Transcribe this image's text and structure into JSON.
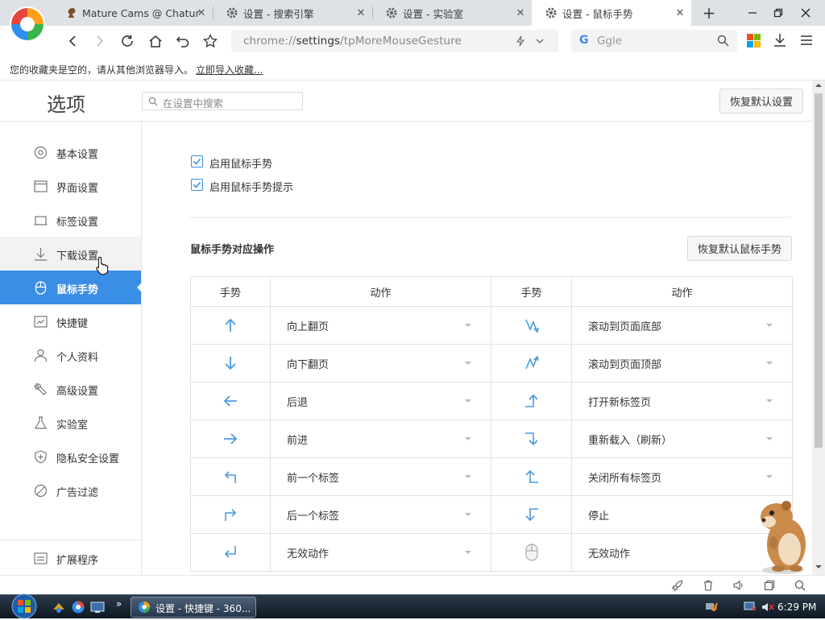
{
  "browser": {
    "tabs": [
      {
        "label": "Mature Cams @ Chatur",
        "icon": "squirrel-icon",
        "active": false
      },
      {
        "label": "设置 - 搜索引擎",
        "icon": "gear-icon",
        "active": false
      },
      {
        "label": "设置 - 实验室",
        "icon": "gear-icon",
        "active": false
      },
      {
        "label": "设置 - 鼠标手势",
        "icon": "gear-icon",
        "active": true
      }
    ],
    "new_tab": "+",
    "url_prefix": "chrome://",
    "url_host": "settings",
    "url_path": "/tpMoreMouseGesture",
    "search_engine_letter": "G",
    "search_placeholder": "Ggle",
    "bookmarks_message": "您的收藏夹是空的，请从其他浏览器导入。",
    "bookmarks_import_link": "立即导入收藏..."
  },
  "settings": {
    "title": "选项",
    "search_placeholder": "在设置中搜索",
    "reset_button": "恢复默认设置",
    "nav": [
      {
        "label": "基本设置",
        "icon": "circle-settings-icon"
      },
      {
        "label": "界面设置",
        "icon": "window-icon"
      },
      {
        "label": "标签设置",
        "icon": "tab-icon"
      },
      {
        "label": "下载设置",
        "icon": "download-icon"
      },
      {
        "label": "鼠标手势",
        "icon": "mouse-icon"
      },
      {
        "label": "快捷键",
        "icon": "keyboard-icon"
      },
      {
        "label": "个人资料",
        "icon": "person-icon"
      },
      {
        "label": "高级设置",
        "icon": "wrench-icon"
      },
      {
        "label": "实验室",
        "icon": "flask-icon"
      },
      {
        "label": "隐私安全设置",
        "icon": "shield-icon"
      },
      {
        "label": "广告过滤",
        "icon": "block-icon"
      }
    ],
    "extensions": "扩展程序",
    "enable_gesture": "启用鼠标手势",
    "enable_gesture_tip": "启用鼠标手势提示",
    "section_title": "鼠标手势对应操作",
    "reset_gesture_button": "恢复默认鼠标手势",
    "table_headers": [
      "手势",
      "动作",
      "手势",
      "动作"
    ],
    "rows": [
      {
        "left_gesture": "arrow-up",
        "left_action": "向上翻页",
        "right_gesture": "down-up",
        "right_action": "滚动到页面底部"
      },
      {
        "left_gesture": "arrow-down",
        "left_action": "向下翻页",
        "right_gesture": "up-down",
        "right_action": "滚动到页面顶部"
      },
      {
        "left_gesture": "arrow-left",
        "left_action": "后退",
        "right_gesture": "right-up",
        "right_action": "打开新标签页"
      },
      {
        "left_gesture": "arrow-right",
        "left_action": "前进",
        "right_gesture": "right-down",
        "right_action": "重新载入（刷新）"
      },
      {
        "left_gesture": "up-left",
        "left_action": "前一个标签",
        "right_gesture": "left-up",
        "right_action": "关闭所有标签页"
      },
      {
        "left_gesture": "up-right",
        "left_action": "后一个标签",
        "right_gesture": "left-down",
        "right_action": "停止"
      },
      {
        "left_gesture": "down-left",
        "left_action": "无效动作",
        "right_gesture": "mouse",
        "right_action": "无效动作"
      }
    ]
  },
  "taskbar": {
    "active_window": "设置 - 快捷键 - 360...",
    "clock": "6:29 PM"
  },
  "colors": {
    "accent": "#3b8ee6",
    "gesture_arrow": "#4a9be0"
  }
}
